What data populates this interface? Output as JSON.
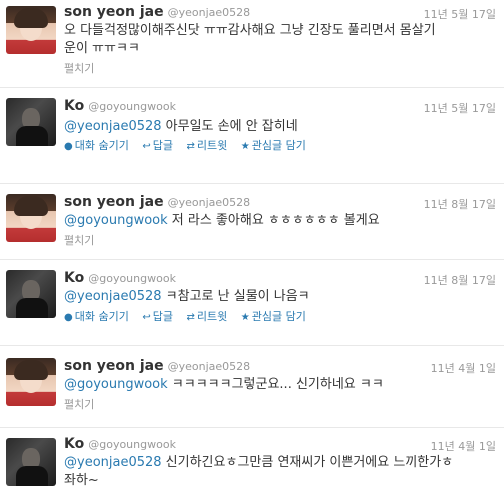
{
  "tweets": [
    {
      "name": "son yeon jae",
      "handle": "@yeonjae0528",
      "date": "11년 5월 17일",
      "mention": "",
      "text_line1": "오 다들걱정많이해주신닷 ㅠㅠ감사해요 그냥 긴장도 풀리면서 몸살기",
      "text_line2": "운이 ㅠㅠㅋㅋ",
      "expand": "펼치기"
    },
    {
      "name": "Ko",
      "handle": "@goyoungwook",
      "date": "11년 5월 17일",
      "mention": "@yeonjae0528",
      "text_line1": " 아무일도 손에 안 잡히네",
      "actions": [
        "대화 숨기기",
        "답글",
        "리트윗",
        "관심글 담기"
      ]
    },
    {
      "name": "son yeon jae",
      "handle": "@yeonjae0528",
      "date": "11년 8월 17일",
      "mention": "@goyoungwook",
      "text_line1": " 저 라스 좋아해요 ㅎㅎㅎㅎㅎㅎ 볼게요",
      "expand": "펼치기"
    },
    {
      "name": "Ko",
      "handle": "@goyoungwook",
      "date": "11년 8월 17일",
      "mention": "@yeonjae0528",
      "text_line1": " ㅋ참고로 난 실물이 나음ㅋ",
      "actions": [
        "대화 숨기기",
        "답글",
        "리트윗",
        "관심글 담기"
      ]
    },
    {
      "name": "son yeon jae",
      "handle": "@yeonjae0528",
      "date": "11년 4월 1일",
      "mention": "@goyoungwook",
      "text_line1": " ㅋㅋㅋㅋㅋ그렇군요... 신기하네요 ㅋㅋ",
      "expand": "펼치기"
    },
    {
      "name": "Ko",
      "handle": "@goyoungwook",
      "date": "11년 4월 1일",
      "mention": "@yeonjae0528",
      "text_line1": " 신기하긴요ㅎ그만큼 연재씨가 이쁜거에요 느끼한가ㅎ",
      "text_line2": "좌하~"
    }
  ],
  "icons": {
    "conversation": "speech-bubble-icon",
    "reply": "reply-arrow-icon",
    "retweet": "retweet-icon",
    "favorite": "star-icon"
  }
}
